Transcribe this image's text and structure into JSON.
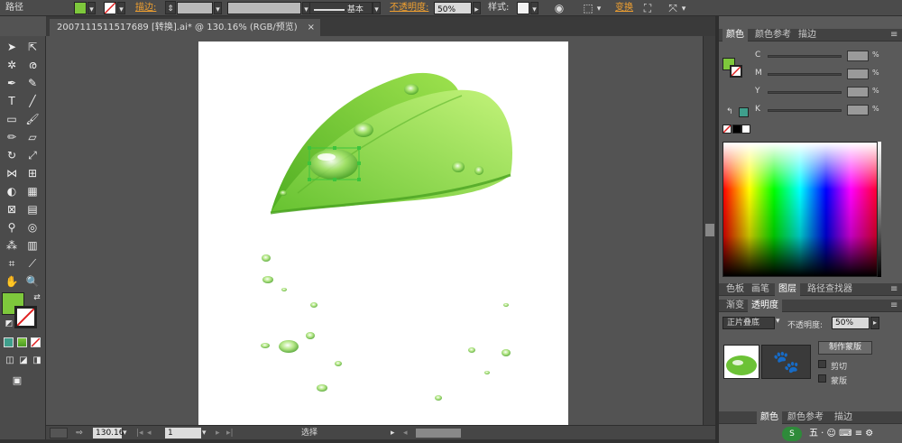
{
  "control_bar": {
    "object_label": "路径",
    "stroke_label": "描边:",
    "stroke_style": "基本",
    "opacity_label": "不透明度:",
    "opacity_value": "50%",
    "style_label": "样式:",
    "transform_label": "变换",
    "fill_color": "#7ec83c"
  },
  "document": {
    "tab_title": "2007111511517689 [转换].ai* @ 130.16% (RGB/预览)",
    "close_glyph": "×"
  },
  "status_bar": {
    "zoom": "130.16",
    "page": "1",
    "tool_name": "选择"
  },
  "color_panel": {
    "tabs": [
      "颜色",
      "颜色参考",
      "描边"
    ],
    "channels": [
      {
        "name": "C",
        "unit": "%"
      },
      {
        "name": "M",
        "unit": "%"
      },
      {
        "name": "Y",
        "unit": "%"
      },
      {
        "name": "K",
        "unit": "%"
      }
    ]
  },
  "swatch_panel": {
    "tabs": [
      "色板",
      "画笔",
      "图层",
      "路径查找器"
    ]
  },
  "transparency_panel": {
    "tabs": [
      "渐变",
      "透明度"
    ],
    "blend_mode": "正片叠底",
    "opacity_label": "不透明度:",
    "opacity_value": "50%",
    "make_mask_label": "制作蒙版",
    "clip_label": "剪切",
    "invert_label": "蒙版"
  },
  "bottom_panel": {
    "tabs": [
      "颜色",
      "颜色参考",
      "描边"
    ]
  },
  "colors": {
    "leaf_dark": "#5cb82a",
    "leaf_light": "#b6ef6a",
    "accent_orange": "#f0a030",
    "selection": "#3cc43c"
  }
}
